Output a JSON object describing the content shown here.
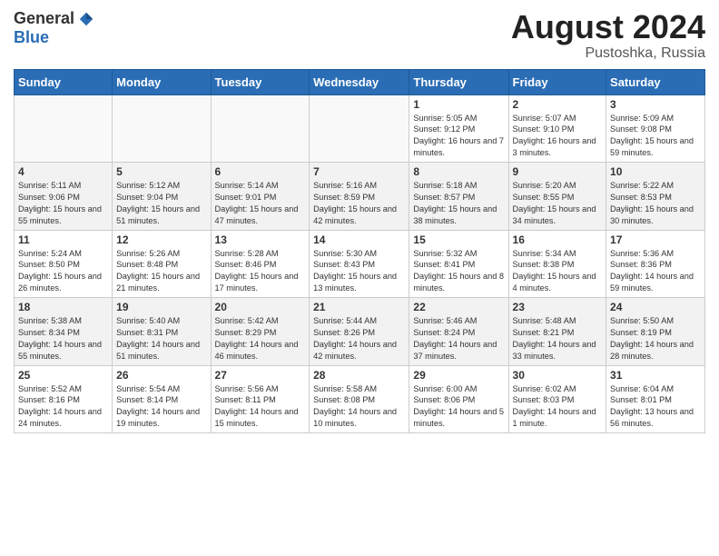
{
  "header": {
    "logo_general": "General",
    "logo_blue": "Blue",
    "title": "August 2024",
    "location": "Pustoshka, Russia"
  },
  "weekdays": [
    "Sunday",
    "Monday",
    "Tuesday",
    "Wednesday",
    "Thursday",
    "Friday",
    "Saturday"
  ],
  "weeks": [
    [
      {
        "day": "",
        "info": ""
      },
      {
        "day": "",
        "info": ""
      },
      {
        "day": "",
        "info": ""
      },
      {
        "day": "",
        "info": ""
      },
      {
        "day": "1",
        "info": "Sunrise: 5:05 AM\nSunset: 9:12 PM\nDaylight: 16 hours\nand 7 minutes."
      },
      {
        "day": "2",
        "info": "Sunrise: 5:07 AM\nSunset: 9:10 PM\nDaylight: 16 hours\nand 3 minutes."
      },
      {
        "day": "3",
        "info": "Sunrise: 5:09 AM\nSunset: 9:08 PM\nDaylight: 15 hours\nand 59 minutes."
      }
    ],
    [
      {
        "day": "4",
        "info": "Sunrise: 5:11 AM\nSunset: 9:06 PM\nDaylight: 15 hours\nand 55 minutes."
      },
      {
        "day": "5",
        "info": "Sunrise: 5:12 AM\nSunset: 9:04 PM\nDaylight: 15 hours\nand 51 minutes."
      },
      {
        "day": "6",
        "info": "Sunrise: 5:14 AM\nSunset: 9:01 PM\nDaylight: 15 hours\nand 47 minutes."
      },
      {
        "day": "7",
        "info": "Sunrise: 5:16 AM\nSunset: 8:59 PM\nDaylight: 15 hours\nand 42 minutes."
      },
      {
        "day": "8",
        "info": "Sunrise: 5:18 AM\nSunset: 8:57 PM\nDaylight: 15 hours\nand 38 minutes."
      },
      {
        "day": "9",
        "info": "Sunrise: 5:20 AM\nSunset: 8:55 PM\nDaylight: 15 hours\nand 34 minutes."
      },
      {
        "day": "10",
        "info": "Sunrise: 5:22 AM\nSunset: 8:53 PM\nDaylight: 15 hours\nand 30 minutes."
      }
    ],
    [
      {
        "day": "11",
        "info": "Sunrise: 5:24 AM\nSunset: 8:50 PM\nDaylight: 15 hours\nand 26 minutes."
      },
      {
        "day": "12",
        "info": "Sunrise: 5:26 AM\nSunset: 8:48 PM\nDaylight: 15 hours\nand 21 minutes."
      },
      {
        "day": "13",
        "info": "Sunrise: 5:28 AM\nSunset: 8:46 PM\nDaylight: 15 hours\nand 17 minutes."
      },
      {
        "day": "14",
        "info": "Sunrise: 5:30 AM\nSunset: 8:43 PM\nDaylight: 15 hours\nand 13 minutes."
      },
      {
        "day": "15",
        "info": "Sunrise: 5:32 AM\nSunset: 8:41 PM\nDaylight: 15 hours\nand 8 minutes."
      },
      {
        "day": "16",
        "info": "Sunrise: 5:34 AM\nSunset: 8:38 PM\nDaylight: 15 hours\nand 4 minutes."
      },
      {
        "day": "17",
        "info": "Sunrise: 5:36 AM\nSunset: 8:36 PM\nDaylight: 14 hours\nand 59 minutes."
      }
    ],
    [
      {
        "day": "18",
        "info": "Sunrise: 5:38 AM\nSunset: 8:34 PM\nDaylight: 14 hours\nand 55 minutes."
      },
      {
        "day": "19",
        "info": "Sunrise: 5:40 AM\nSunset: 8:31 PM\nDaylight: 14 hours\nand 51 minutes."
      },
      {
        "day": "20",
        "info": "Sunrise: 5:42 AM\nSunset: 8:29 PM\nDaylight: 14 hours\nand 46 minutes."
      },
      {
        "day": "21",
        "info": "Sunrise: 5:44 AM\nSunset: 8:26 PM\nDaylight: 14 hours\nand 42 minutes."
      },
      {
        "day": "22",
        "info": "Sunrise: 5:46 AM\nSunset: 8:24 PM\nDaylight: 14 hours\nand 37 minutes."
      },
      {
        "day": "23",
        "info": "Sunrise: 5:48 AM\nSunset: 8:21 PM\nDaylight: 14 hours\nand 33 minutes."
      },
      {
        "day": "24",
        "info": "Sunrise: 5:50 AM\nSunset: 8:19 PM\nDaylight: 14 hours\nand 28 minutes."
      }
    ],
    [
      {
        "day": "25",
        "info": "Sunrise: 5:52 AM\nSunset: 8:16 PM\nDaylight: 14 hours\nand 24 minutes."
      },
      {
        "day": "26",
        "info": "Sunrise: 5:54 AM\nSunset: 8:14 PM\nDaylight: 14 hours\nand 19 minutes."
      },
      {
        "day": "27",
        "info": "Sunrise: 5:56 AM\nSunset: 8:11 PM\nDaylight: 14 hours\nand 15 minutes."
      },
      {
        "day": "28",
        "info": "Sunrise: 5:58 AM\nSunset: 8:08 PM\nDaylight: 14 hours\nand 10 minutes."
      },
      {
        "day": "29",
        "info": "Sunrise: 6:00 AM\nSunset: 8:06 PM\nDaylight: 14 hours\nand 5 minutes."
      },
      {
        "day": "30",
        "info": "Sunrise: 6:02 AM\nSunset: 8:03 PM\nDaylight: 14 hours\nand 1 minute."
      },
      {
        "day": "31",
        "info": "Sunrise: 6:04 AM\nSunset: 8:01 PM\nDaylight: 13 hours\nand 56 minutes."
      }
    ]
  ]
}
